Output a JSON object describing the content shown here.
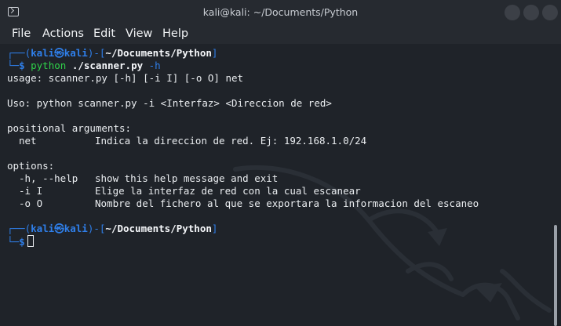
{
  "window": {
    "title": "kali@kali: ~/Documents/Python"
  },
  "menu": [
    "File",
    "Actions",
    "Edit",
    "View",
    "Help"
  ],
  "prompt": {
    "user": "kali",
    "sep": "㉿",
    "host": "kali",
    "path": "~/Documents/Python"
  },
  "command": {
    "program": "python",
    "script": "./scanner.py",
    "flag": "-h"
  },
  "output": {
    "usage": "usage: scanner.py [-h] [-i I] [-o O] net",
    "uso": "Uso: python scanner.py -i <Interfaz> <Direccion de red>",
    "positional_header": "positional arguments:",
    "positional": [
      {
        "arg": "net",
        "desc": "Indica la direccion de red. Ej: 192.168.1.0/24"
      }
    ],
    "options_header": "options:",
    "options": [
      {
        "arg": "-h, --help",
        "desc": "show this help message and exit"
      },
      {
        "arg": "-i I",
        "desc": "Elige la interfaz de red con la cual escanear"
      },
      {
        "arg": "-o O",
        "desc": "Nombre del fichero al que se exportara la informacion del escaneo"
      }
    ]
  },
  "colors": {
    "prompt_blue": "#2f7fea",
    "command_green": "#2fd34a",
    "background": "#1f2329"
  }
}
